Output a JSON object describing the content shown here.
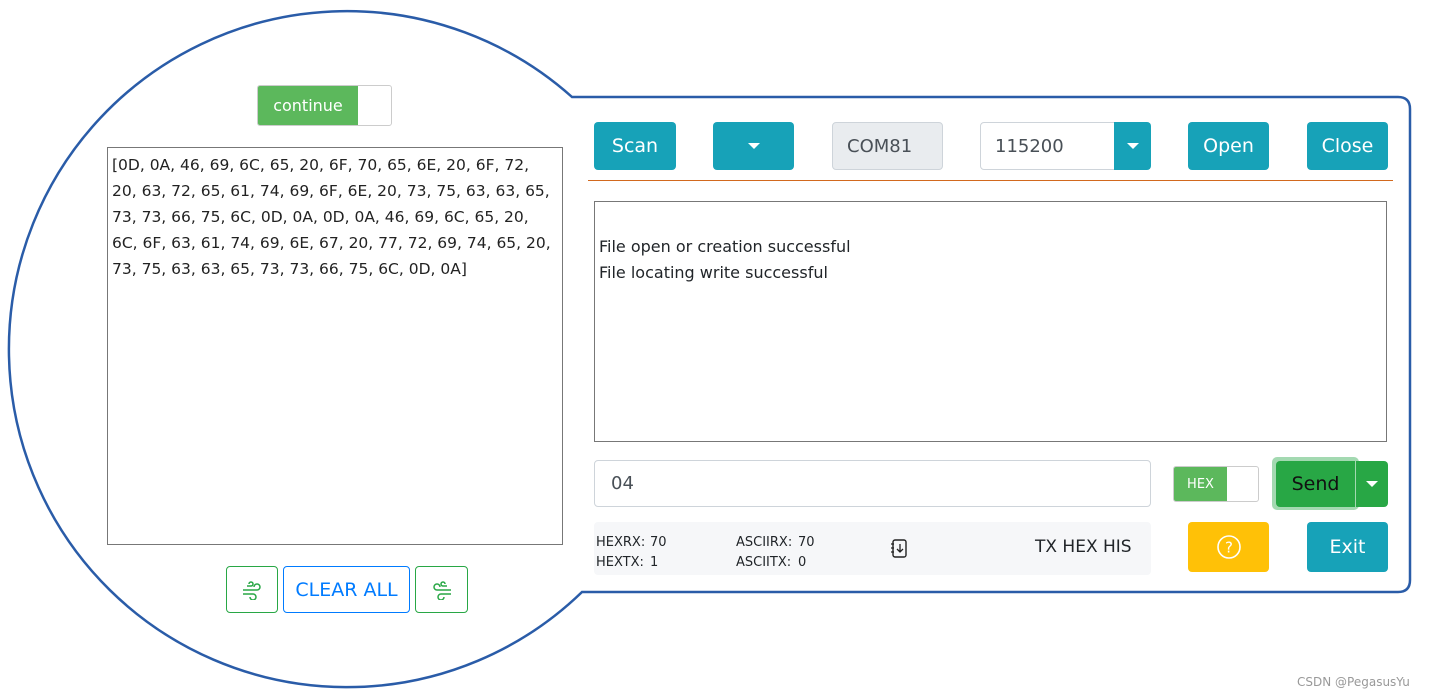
{
  "left_panel": {
    "toggle_label": "continue",
    "hex_output": "[0D, 0A, 46, 69, 6C, 65, 20, 6F, 70, 65, 6E, 20, 6F, 72, 20, 63, 72, 65, 61, 74, 69, 6F, 6E, 20, 73, 75, 63, 63, 65, 73, 73, 66, 75, 6C, 0D, 0A, 0D, 0A, 46, 69, 6C, 65, 20, 6C, 6F, 63, 61, 74, 69, 6E, 67, 20, 77, 72, 69, 74, 65, 20, 73, 75, 63, 63, 65, 73, 73, 66, 75, 6C, 0D, 0A]",
    "clear_all_label": "CLEAR ALL"
  },
  "toolbar": {
    "scan_label": "Scan",
    "port_value": "COM81",
    "baud_value": "115200",
    "open_label": "Open",
    "close_label": "Close"
  },
  "receive_lines": [
    "File open or creation successful",
    "File locating write successful"
  ],
  "send": {
    "input_value": "04",
    "hex_toggle_label": "HEX",
    "send_label": "Send"
  },
  "stats": {
    "hexrx_label": "HEXRX:",
    "hexrx": "70",
    "hextx_label": "HEXTX:",
    "hextx": "1",
    "asciirx_label": "ASCIIRX:",
    "asciirx": "70",
    "asciitx_label": "ASCIITX:",
    "asciitx": "0",
    "history_label": "TX HEX HIS"
  },
  "exit_label": "Exit",
  "watermark": "CSDN @PegasusYu",
  "colors": {
    "outline": "#2a5ca8",
    "teal": "#17a2b8",
    "green": "#28a745",
    "yellow": "#ffc107",
    "blue": "#007bff"
  }
}
